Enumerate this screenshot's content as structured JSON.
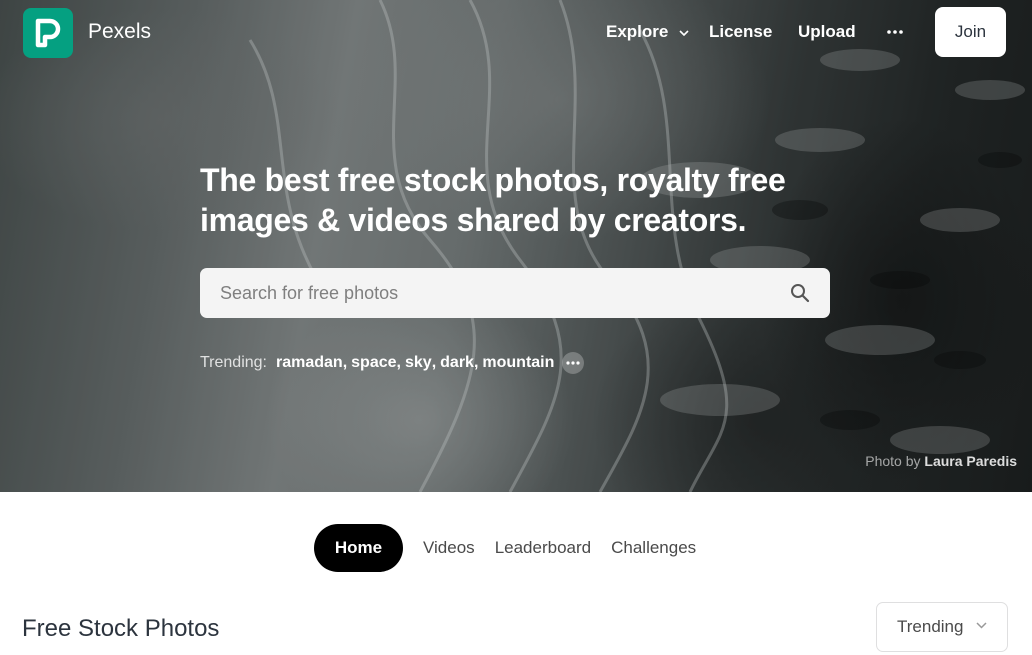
{
  "brand": {
    "name": "Pexels",
    "logo_letter": "P",
    "logo_color": "#05a081"
  },
  "nav": {
    "explore": "Explore",
    "license": "License",
    "upload": "Upload",
    "more_icon": "ellipsis-icon",
    "join": "Join"
  },
  "hero": {
    "headline": "The best free stock photos, royalty free images & videos shared by creators.",
    "search_placeholder": "Search for free photos",
    "search_icon": "search-icon",
    "trending_label": "Trending:",
    "trending": [
      "ramadan",
      "space",
      "sky",
      "dark",
      "mountain"
    ],
    "credit_prefix": "Photo by",
    "credit_name": "Laura Paredis"
  },
  "tabs": [
    {
      "label": "Home",
      "active": true
    },
    {
      "label": "Videos",
      "active": false
    },
    {
      "label": "Leaderboard",
      "active": false
    },
    {
      "label": "Challenges",
      "active": false
    }
  ],
  "section": {
    "title": "Free Stock Photos",
    "sort_value": "Trending"
  }
}
